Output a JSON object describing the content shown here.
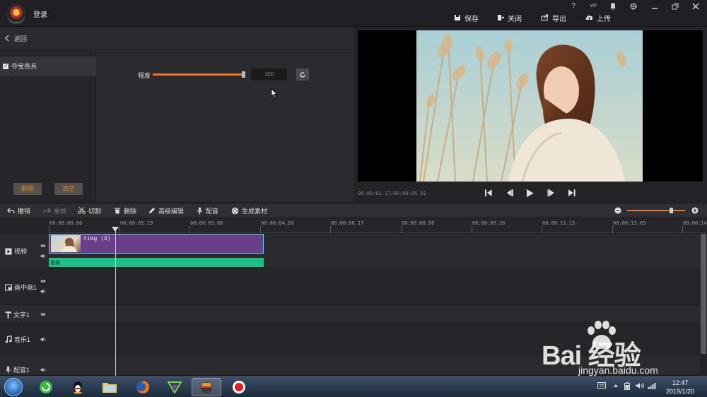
{
  "app": {
    "login_label": "登录",
    "window_icons": [
      "?",
      "VIP",
      "bell-icon",
      "gear-icon",
      "minimize-icon",
      "restore-icon",
      "close-icon"
    ],
    "actions": [
      {
        "label": "保存",
        "icon": "save-icon"
      },
      {
        "label": "关闭",
        "icon": "exit-icon"
      },
      {
        "label": "导出",
        "icon": "export-icon"
      },
      {
        "label": "上传",
        "icon": "upload-icon"
      }
    ]
  },
  "effects_panel": {
    "back_label": "返回",
    "items": [
      {
        "label": "夺宝奇兵",
        "checked": true
      }
    ],
    "delete_label": "删除",
    "clear_label": "清空",
    "degree_label": "程度",
    "degree_value": "100",
    "degree_fraction": 1.0
  },
  "preview": {
    "timecode": "00:00:01.17/00:00:05.02"
  },
  "toolbar": {
    "undo": "撤销",
    "redo": "重做",
    "cut": "切割",
    "delete": "删除",
    "advanced_edit": "高级编辑",
    "dub": "配音",
    "generate": "生成素材",
    "zoom_fraction": 0.75
  },
  "timeline": {
    "ruler_labels": [
      "00:00:00.00",
      "00:00:01.19",
      "00:00:03.08",
      "00:00:04.28",
      "00:00:06.17",
      "00:00:08.06",
      "00:00:09.26",
      "00:00:11.15",
      "00:00:13.05",
      "00:00:14:"
    ],
    "tracks": [
      {
        "label": "视频",
        "icon": "play-square-icon"
      },
      {
        "label": "画中画1",
        "icon": "pip-icon"
      },
      {
        "label": "文字1",
        "icon": "text-icon"
      },
      {
        "label": "音乐1",
        "icon": "music-note-icon"
      },
      {
        "label": "配音1",
        "icon": "microphone-icon"
      }
    ],
    "clip_name": "timg (4)",
    "effect_clip_label": "旋辑"
  },
  "watermark": {
    "brand": "Bai  经验",
    "url": "jingyan.baidu.com"
  },
  "taskbar": {
    "time": "12:47",
    "date": "2019/1/20"
  },
  "colors": {
    "accent": "#f07822",
    "clip_purple": "#6a3f8a",
    "clip_border": "#5ad0ea",
    "effect_green": "#1fbf8a"
  }
}
